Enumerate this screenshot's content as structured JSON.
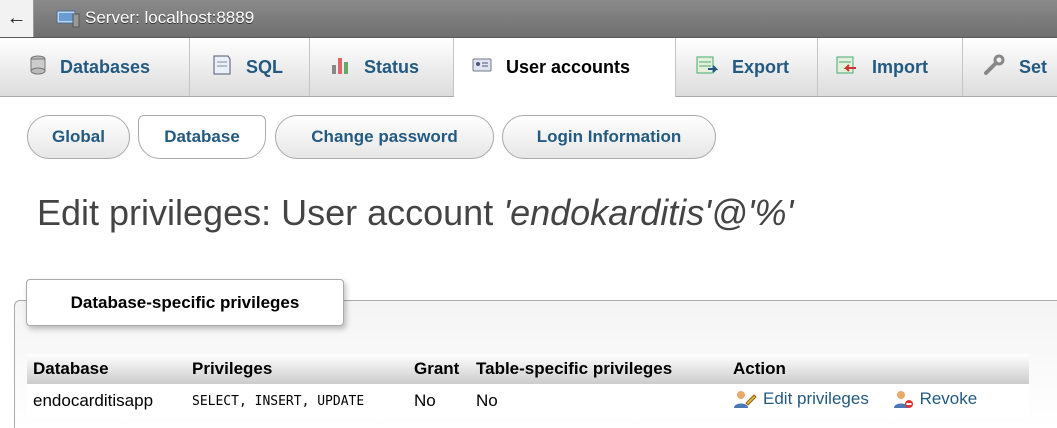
{
  "topbar": {
    "back_icon": "←",
    "server_label": "Server: localhost:8889"
  },
  "tabs": [
    {
      "label": "Databases",
      "icon": "database-icon"
    },
    {
      "label": "SQL",
      "icon": "sql-icon"
    },
    {
      "label": "Status",
      "icon": "status-icon"
    },
    {
      "label": "User accounts",
      "icon": "user-accounts-icon",
      "active": true
    },
    {
      "label": "Export",
      "icon": "export-icon"
    },
    {
      "label": "Import",
      "icon": "import-icon"
    },
    {
      "label": "Set",
      "icon": "settings-icon"
    }
  ],
  "subtabs": [
    {
      "label": "Global"
    },
    {
      "label": "Database",
      "active": true
    },
    {
      "label": "Change password"
    },
    {
      "label": "Login Information"
    }
  ],
  "page": {
    "title_prefix": "Edit privileges: User account ",
    "title_account": "'endokarditis'@'%'"
  },
  "fieldset": {
    "legend": "Database-specific privileges",
    "columns": [
      "Database",
      "Privileges",
      "Grant",
      "Table-specific privileges",
      "Action"
    ],
    "rows": [
      {
        "database": "endocarditisapp",
        "privileges": "SELECT, INSERT, UPDATE",
        "grant": "No",
        "table_specific": "No",
        "edit_label": "Edit privileges",
        "revoke_label": "Revoke"
      }
    ]
  },
  "colors": {
    "link": "#235a81",
    "title": "#444444"
  }
}
